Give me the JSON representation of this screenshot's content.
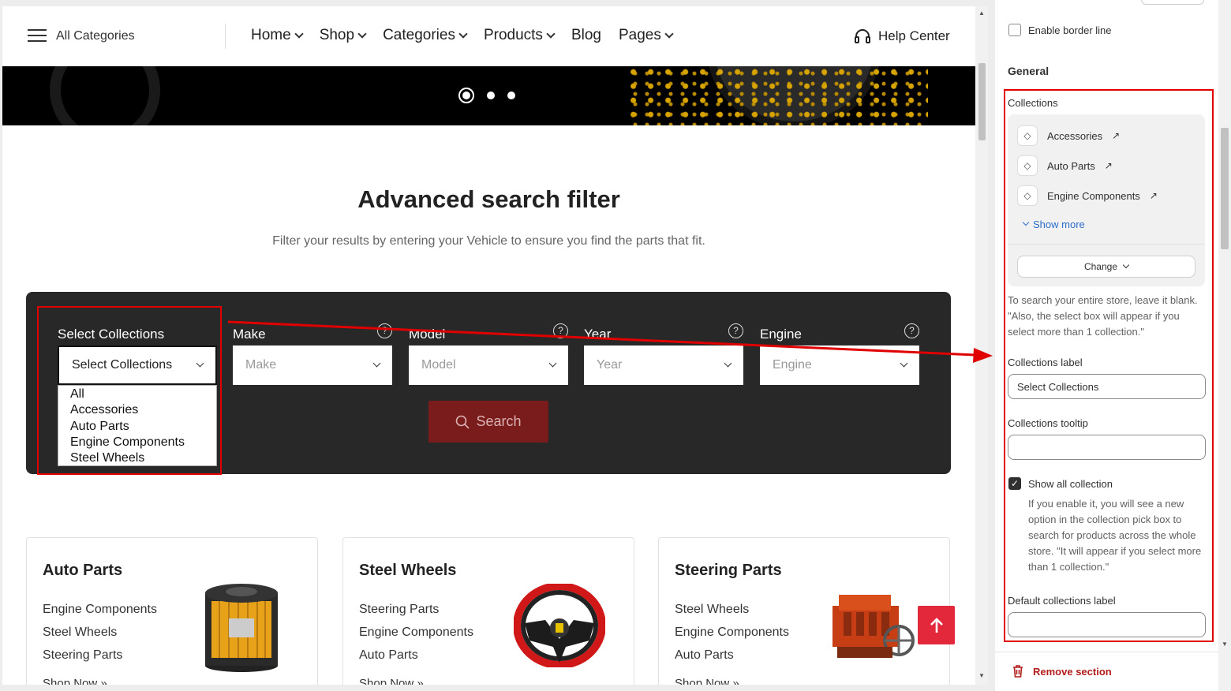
{
  "header": {
    "all_categories": "All Categories",
    "nav": [
      "Home",
      "Shop",
      "Categories",
      "Products",
      "Blog",
      "Pages"
    ],
    "help_center": "Help Center"
  },
  "search_section": {
    "title": "Advanced search filter",
    "subtitle": "Filter your results by entering your Vehicle to ensure you find the parts that fit.",
    "fields": [
      {
        "label": "Select Collections",
        "value": "Select Collections"
      },
      {
        "label": "Make",
        "placeholder": "Make"
      },
      {
        "label": "Model",
        "placeholder": "Model"
      },
      {
        "label": "Year",
        "placeholder": "Year"
      },
      {
        "label": "Engine",
        "placeholder": "Engine"
      }
    ],
    "help_glyph": "?",
    "dropdown_options": [
      "All",
      "Accessories",
      "Auto Parts",
      "Engine Components",
      "Steel Wheels"
    ],
    "search_button": "Search"
  },
  "cards": [
    {
      "title": "Auto Parts",
      "links": [
        "Engine Components",
        "Steel Wheels",
        "Steering Parts"
      ],
      "shop": "Shop Now »"
    },
    {
      "title": "Steel Wheels",
      "links": [
        "Steering Parts",
        "Engine Components",
        "Auto Parts"
      ],
      "shop": "Shop Now »"
    },
    {
      "title": "Steering Parts",
      "links": [
        "Steel Wheels",
        "Engine Components",
        "Auto Parts"
      ],
      "shop": "Shop Now »"
    }
  ],
  "panel": {
    "enable_border": "Enable border line",
    "general_heading": "General",
    "collections_heading": "Collections",
    "collections": [
      "Accessories",
      "Auto Parts",
      "Engine Components"
    ],
    "show_more": "Show more",
    "change_button": "Change",
    "collections_help": "To search your entire store, leave it blank. \"Also, the select box will appear if you select more than 1 collection.\"",
    "collections_label_heading": "Collections label",
    "collections_label_value": "Select Collections",
    "collections_tooltip_heading": "Collections tooltip",
    "collections_tooltip_value": "",
    "show_all_label": "Show all collection",
    "show_all_help": "If you enable it, you will see a new option in the collection pick box to search for products across the whole store. \"It will appear if you select more than 1 collection.\"",
    "default_label_heading": "Default collections label",
    "default_label_value": "",
    "remove_section": "Remove section"
  },
  "colors": {
    "accent_red": "#e10000",
    "search_button": "#7a1c1c",
    "scroll_top_button": "#e3283b",
    "link_blue": "#2c6ecb"
  }
}
